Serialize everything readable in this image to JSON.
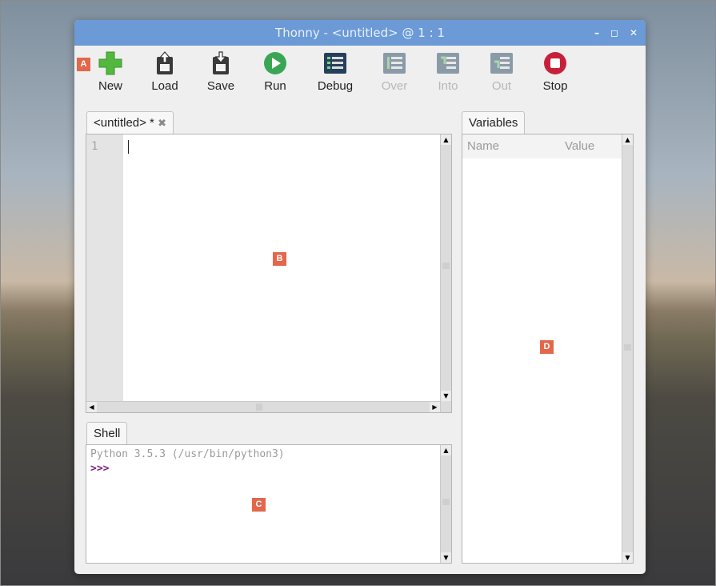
{
  "window": {
    "title": "Thonny  -  <untitled>  @  1 : 1"
  },
  "window_controls": {
    "minimize": "–",
    "maximize": "◻",
    "close": "✕"
  },
  "toolbar": {
    "buttons": [
      {
        "label": "New",
        "icon": "plus-icon",
        "enabled": true
      },
      {
        "label": "Load",
        "icon": "load-icon",
        "enabled": true
      },
      {
        "label": "Save",
        "icon": "save-icon",
        "enabled": true
      },
      {
        "label": "Run",
        "icon": "run-icon",
        "enabled": true
      },
      {
        "label": "Debug",
        "icon": "debug-icon",
        "enabled": true
      },
      {
        "label": "Over",
        "icon": "step-over-icon",
        "enabled": false
      },
      {
        "label": "Into",
        "icon": "step-into-icon",
        "enabled": false
      },
      {
        "label": "Out",
        "icon": "step-out-icon",
        "enabled": false
      },
      {
        "label": "Stop",
        "icon": "stop-icon",
        "enabled": true
      }
    ]
  },
  "editor": {
    "tab_label": "<untitled> *",
    "line_numbers": [
      "1"
    ]
  },
  "shell": {
    "tab_label": "Shell",
    "banner": "Python 3.5.3 (/usr/bin/python3)",
    "prompt": ">>>"
  },
  "variables": {
    "tab_label": "Variables",
    "columns": [
      "Name",
      "Value"
    ]
  },
  "markers": {
    "a": "A",
    "b": "B",
    "c": "C",
    "d": "D"
  },
  "colors": {
    "titlebar": "#6b9ad6",
    "marker": "#e2674b",
    "run": "#3aa655",
    "stop": "#c8203a",
    "new": "#52b93e"
  }
}
